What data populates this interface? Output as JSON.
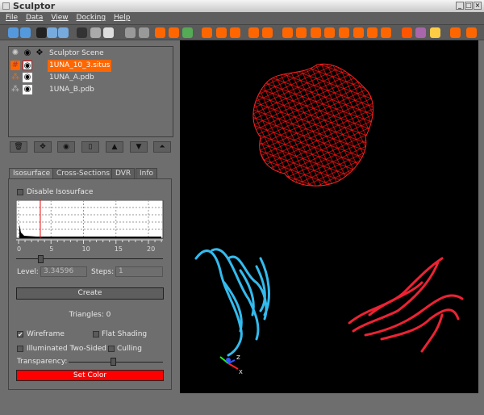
{
  "window": {
    "title": "Sculptor"
  },
  "menu": [
    "File",
    "Data",
    "View",
    "Docking",
    "Help"
  ],
  "scene_tree": {
    "items": [
      {
        "label": "Sculptor Scene",
        "icon": "scene-icon",
        "selected": false
      },
      {
        "label": "1UNA_10_3.situs",
        "icon": "volume-grid-icon",
        "selected": true
      },
      {
        "label": "1UNA_A.pdb",
        "icon": "molecule-icon",
        "selected": false
      },
      {
        "label": "1UNA_B.pdb",
        "icon": "molecule-icon",
        "selected": false
      }
    ]
  },
  "scene_buttons": [
    "delete-icon",
    "move-icon",
    "eye-icon",
    "properties-icon",
    "up-icon",
    "down-icon",
    "top-icon"
  ],
  "tabs": [
    "Isosurface",
    "Cross-Sections",
    "DVR",
    "Info"
  ],
  "isosurface": {
    "disable_label": "Disable Isosurface",
    "disable_checked": false,
    "histogram_ticks": [
      "0",
      "5",
      "10",
      "15",
      "20"
    ],
    "level_marker": 3.34596,
    "level_label": "Level:",
    "level_value": "3.34596",
    "steps_label": "Steps:",
    "steps_value": "1",
    "create_label": "Create",
    "triangles": "Triangles: 0",
    "wireframe_label": "Wireframe",
    "wireframe_checked": true,
    "flat_label": "Flat Shading",
    "flat_checked": false,
    "illum_label": "Illuminated Two-Sided",
    "illum_checked": false,
    "culling_label": "Culling",
    "culling_checked": false,
    "transparency_label": "Transparency:",
    "transparency": 0.5,
    "set_color_label": "Set Color",
    "color": "#ff0000"
  },
  "colors": {
    "accent": "#ff6600",
    "selection": "#ff6600",
    "isosurface": "#ff0000",
    "chain_a": "#33bbee",
    "chain_b": "#ee2233"
  },
  "axes": {
    "x": "X",
    "y": "Y",
    "z": "Z"
  }
}
